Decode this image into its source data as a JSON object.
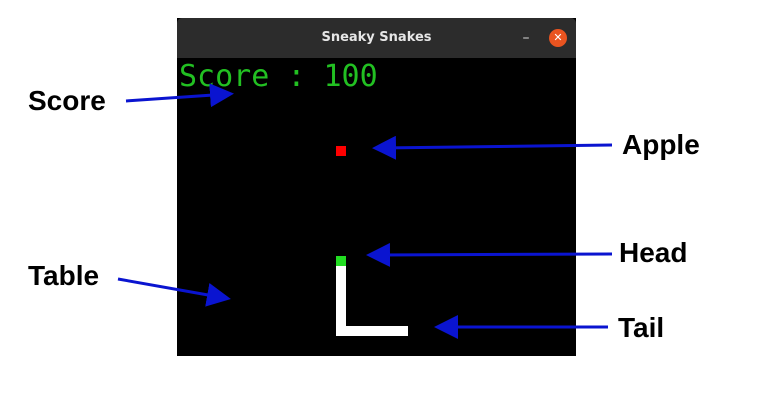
{
  "window": {
    "title": "Sneaky Snakes",
    "minimize_glyph": "–",
    "close_glyph": "✕"
  },
  "game": {
    "score_text": "Score : 100",
    "colors": {
      "background": "#000000",
      "score": "#22c022",
      "apple": "#ff0000",
      "head": "#22dd22",
      "tail": "#ffffff"
    }
  },
  "annotations": {
    "score": "Score",
    "apple": "Apple",
    "table": "Table",
    "head": "Head",
    "tail": "Tail",
    "arrow_color": "#0a14d0"
  }
}
